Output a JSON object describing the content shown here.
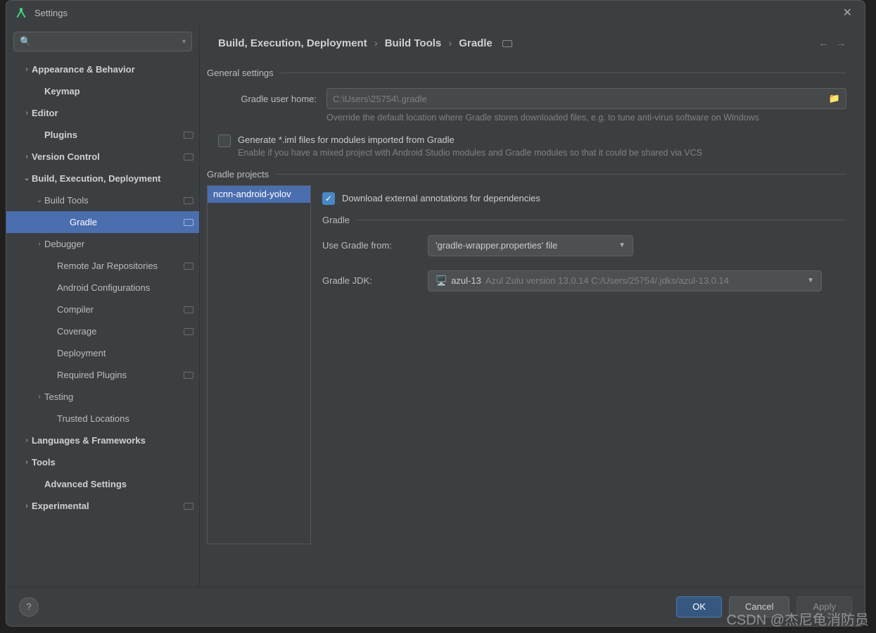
{
  "window": {
    "title": "Settings"
  },
  "search": {
    "placeholder": ""
  },
  "sidebar": {
    "items": [
      {
        "label": "Appearance & Behavior",
        "chev": "›",
        "bold": true,
        "pad": 1,
        "badge": false
      },
      {
        "label": "Keymap",
        "chev": "",
        "bold": true,
        "pad": 2,
        "badge": false
      },
      {
        "label": "Editor",
        "chev": "›",
        "bold": true,
        "pad": 1,
        "badge": false
      },
      {
        "label": "Plugins",
        "chev": "",
        "bold": true,
        "pad": 2,
        "badge": true
      },
      {
        "label": "Version Control",
        "chev": "›",
        "bold": true,
        "pad": 1,
        "badge": true
      },
      {
        "label": "Build, Execution, Deployment",
        "chev": "⌄",
        "bold": true,
        "pad": 1,
        "badge": false
      },
      {
        "label": "Build Tools",
        "chev": "⌄",
        "bold": false,
        "pad": 2,
        "badge": true
      },
      {
        "label": "Gradle",
        "chev": "",
        "bold": false,
        "pad": 4,
        "badge": true,
        "selected": true
      },
      {
        "label": "Debugger",
        "chev": "›",
        "bold": false,
        "pad": 2,
        "badge": false
      },
      {
        "label": "Remote Jar Repositories",
        "chev": "",
        "bold": false,
        "pad": 3,
        "badge": true
      },
      {
        "label": "Android Configurations",
        "chev": "",
        "bold": false,
        "pad": 3,
        "badge": false
      },
      {
        "label": "Compiler",
        "chev": "",
        "bold": false,
        "pad": 3,
        "badge": true
      },
      {
        "label": "Coverage",
        "chev": "",
        "bold": false,
        "pad": 3,
        "badge": true
      },
      {
        "label": "Deployment",
        "chev": "",
        "bold": false,
        "pad": 3,
        "badge": false
      },
      {
        "label": "Required Plugins",
        "chev": "",
        "bold": false,
        "pad": 3,
        "badge": true
      },
      {
        "label": "Testing",
        "chev": "›",
        "bold": false,
        "pad": 2,
        "badge": false
      },
      {
        "label": "Trusted Locations",
        "chev": "",
        "bold": false,
        "pad": 3,
        "badge": false
      },
      {
        "label": "Languages & Frameworks",
        "chev": "›",
        "bold": true,
        "pad": 1,
        "badge": false
      },
      {
        "label": "Tools",
        "chev": "›",
        "bold": true,
        "pad": 1,
        "badge": false
      },
      {
        "label": "Advanced Settings",
        "chev": "",
        "bold": true,
        "pad": 2,
        "badge": false
      },
      {
        "label": "Experimental",
        "chev": "›",
        "bold": true,
        "pad": 1,
        "badge": true
      }
    ]
  },
  "breadcrumb": {
    "a": "Build, Execution, Deployment",
    "b": "Build Tools",
    "c": "Gradle"
  },
  "sections": {
    "general": "General settings",
    "projects": "Gradle projects",
    "gradle_sub": "Gradle"
  },
  "general": {
    "user_home_label": "Gradle user home:",
    "user_home_placeholder": "C:\\Users\\25754\\.gradle",
    "user_home_hint": "Override the default location where Gradle stores downloaded files, e.g. to tune anti-virus software on Windows",
    "gen_iml_label": "Generate *.iml files for modules imported from Gradle",
    "gen_iml_hint": "Enable if you have a mixed project with Android Studio modules and Gradle modules so that it could be shared via VCS"
  },
  "projects": {
    "list": [
      "ncnn-android-yolov"
    ],
    "download_annotations": "Download external annotations for dependencies",
    "use_from_label": "Use Gradle from:",
    "use_from_value": "'gradle-wrapper.properties' file",
    "jdk_label": "Gradle JDK:",
    "jdk_name": "azul-13",
    "jdk_detail": "Azul Zulu version 13.0.14 C:/Users/25754/.jdks/azul-13.0.14"
  },
  "footer": {
    "ok": "OK",
    "cancel": "Cancel",
    "apply": "Apply",
    "help": "?"
  },
  "watermark": "CSDN @杰尼龟消防员"
}
